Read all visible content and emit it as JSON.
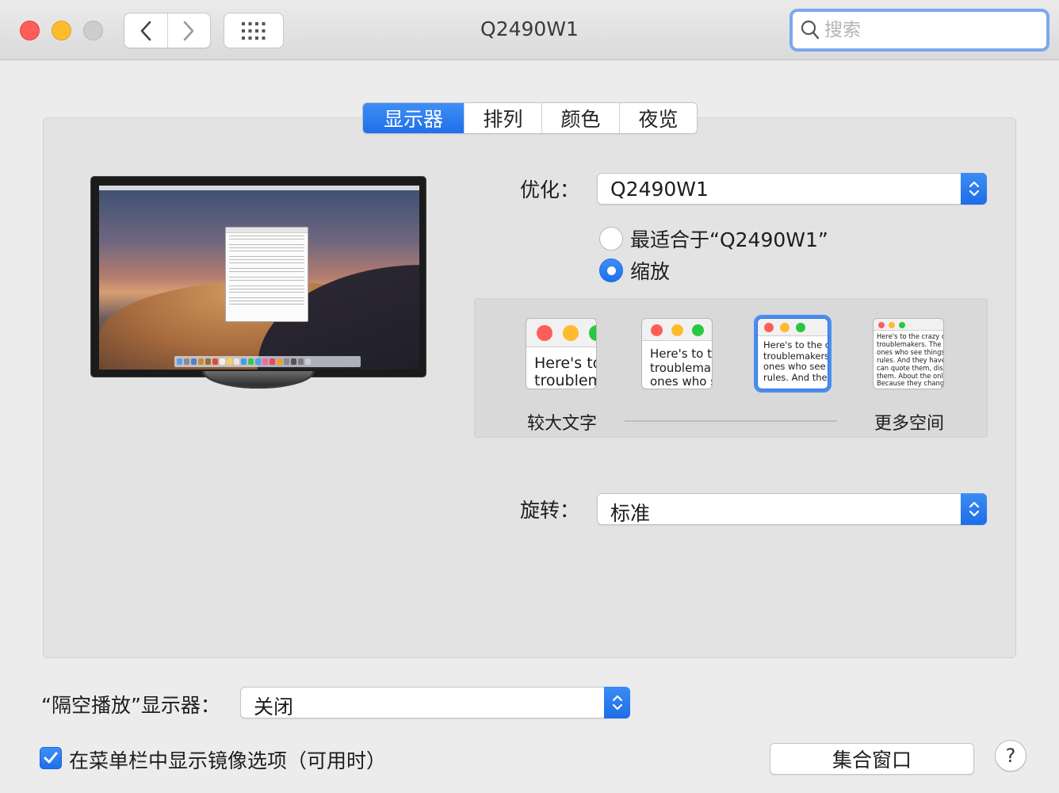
{
  "window": {
    "title": "Q2490W1",
    "search_placeholder": "搜索"
  },
  "tabs": [
    {
      "label": "显示器",
      "active": true
    },
    {
      "label": "排列",
      "active": false
    },
    {
      "label": "颜色",
      "active": false
    },
    {
      "label": "夜览",
      "active": false
    }
  ],
  "optimize": {
    "label": "优化：",
    "value": "Q2490W1"
  },
  "resolution": {
    "options": [
      {
        "label": "最适合于“Q2490W1”",
        "selected": false
      },
      {
        "label": "缩放",
        "selected": true
      }
    ]
  },
  "scale": {
    "thumbnails": [
      {
        "text": "Here's to\ntroublem",
        "selected": false
      },
      {
        "text": "Here's to th\ntroublemak\nones who s",
        "selected": false
      },
      {
        "text": "Here's to the cr\ntroublemakers.\nones who see t\nrules. And they",
        "selected": true
      },
      {
        "text": "Here's to the crazy one\ntroublemakers. The rou\nones who see things dif\nrules. And they have no\ncan quote them, disagre\nthem. About the only th\nBecause they change t",
        "selected": false
      }
    ],
    "left_label": "较大文字",
    "right_label": "更多空间"
  },
  "rotation": {
    "label": "旋转：",
    "value": "标准"
  },
  "airplay": {
    "label": "“隔空播放”显示器：",
    "value": "关闭"
  },
  "mirror_option": {
    "label": "在菜单栏中显示镜像选项（可用时）",
    "checked": true
  },
  "gather_button": "集合窗口",
  "help_button": "?",
  "colors": {
    "accent": "#1f6fe9",
    "close": "#fd5e57",
    "minimize": "#febb2e"
  }
}
